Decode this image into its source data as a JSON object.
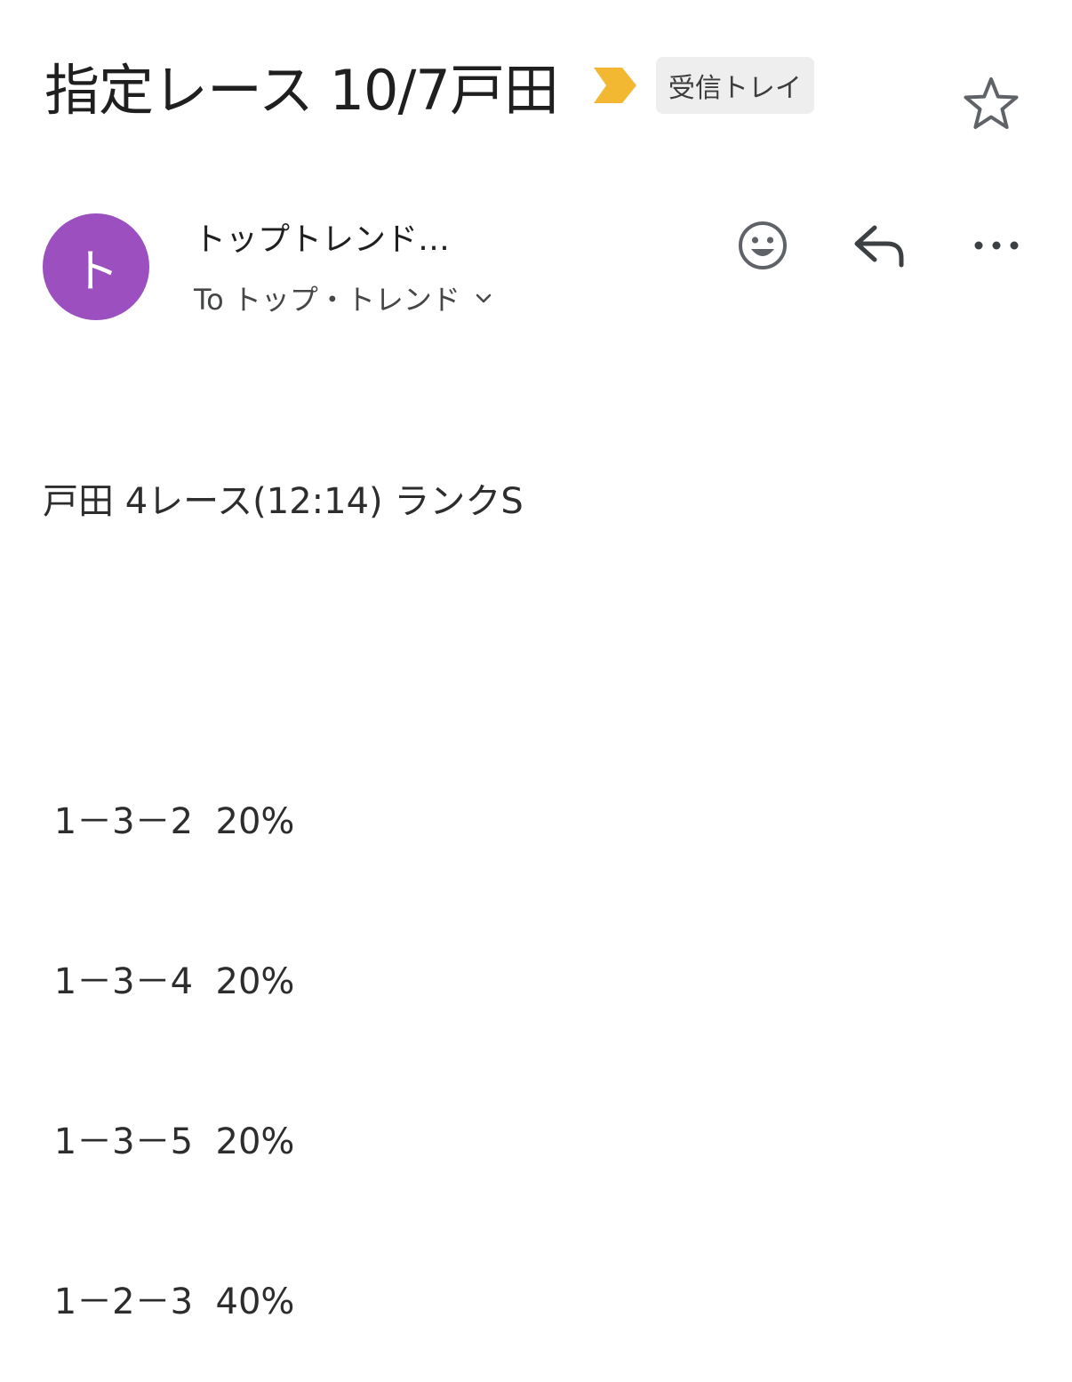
{
  "header": {
    "subject": "指定レース 10/7戸田",
    "label": "受信トレイ",
    "importance_marker_color": "#F2B832",
    "star_icon": "star-outline-icon"
  },
  "sender": {
    "avatar_initial": "ト",
    "avatar_color": "#9C4FBF",
    "name": "トップトレンド…",
    "recipient": "To トップ・トレンド"
  },
  "actions": {
    "emoji_icon": "smiley-icon",
    "reply_icon": "reply-icon",
    "more_icon": "more-horizontal-icon"
  },
  "message": {
    "lines": [
      "戸田 4レース(12:14) ランクS",
      "",
      " 1－3－2  20%",
      " 1－3－4  20%",
      " 1－3－5  20%",
      " 1－2－3  40%"
    ]
  }
}
